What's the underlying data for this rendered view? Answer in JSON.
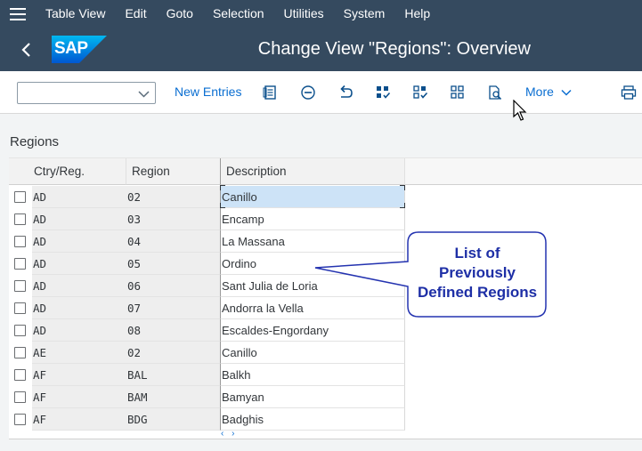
{
  "menu": {
    "items": [
      "Table View",
      "Edit",
      "Goto",
      "Selection",
      "Utilities",
      "System",
      "Help"
    ]
  },
  "header": {
    "logo_text": "SAP",
    "title": "Change View \"Regions\": Overview"
  },
  "toolbar": {
    "select_value": "",
    "new_entries": "New Entries",
    "more": "More"
  },
  "section": {
    "title": "Regions"
  },
  "table": {
    "columns": [
      "Ctry/Reg.",
      "Region",
      "Description"
    ],
    "rows": [
      {
        "ctry": "AD",
        "region": "02",
        "desc": "Canillo"
      },
      {
        "ctry": "AD",
        "region": "03",
        "desc": "Encamp"
      },
      {
        "ctry": "AD",
        "region": "04",
        "desc": "La Massana"
      },
      {
        "ctry": "AD",
        "region": "05",
        "desc": "Ordino"
      },
      {
        "ctry": "AD",
        "region": "06",
        "desc": "Sant Julia de Loria"
      },
      {
        "ctry": "AD",
        "region": "07",
        "desc": "Andorra la Vella"
      },
      {
        "ctry": "AD",
        "region": "08",
        "desc": "Escaldes-Engordany"
      },
      {
        "ctry": "AE",
        "region": "02",
        "desc": "Canillo"
      },
      {
        "ctry": "AF",
        "region": "BAL",
        "desc": "Balkh"
      },
      {
        "ctry": "AF",
        "region": "BAM",
        "desc": "Bamyan"
      },
      {
        "ctry": "AF",
        "region": "BDG",
        "desc": "Badghis"
      }
    ]
  },
  "callout": {
    "line1": "List of",
    "line2": "Previously",
    "line3": "Defined Regions"
  },
  "colors": {
    "shell": "#354a5f",
    "accent": "#0a6ed1",
    "callout_text": "#1e2fa6"
  }
}
